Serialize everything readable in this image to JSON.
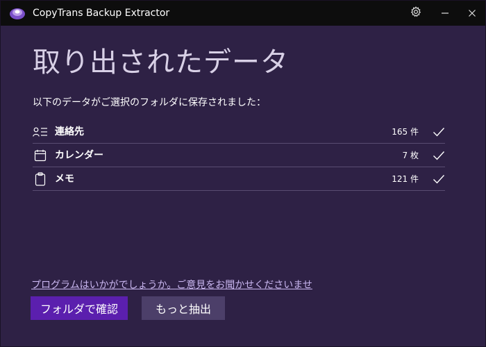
{
  "window": {
    "title": "CopyTrans Backup Extractor"
  },
  "titlebar_icons": {
    "settings": "gear-icon",
    "minimize": "minimize-icon",
    "close": "close-icon"
  },
  "main": {
    "heading": "取り出されたデータ",
    "subtitle": "以下のデータがご選択のフォルダに保存されました：",
    "items": [
      {
        "icon": "contacts-icon",
        "label": "連絡先",
        "count": "165 件",
        "status": "check-icon"
      },
      {
        "icon": "calendar-icon",
        "label": "カレンダー",
        "count": "7 枚",
        "status": "check-icon"
      },
      {
        "icon": "clipboard-icon",
        "label": "メモ",
        "count": "121 件",
        "status": "check-icon"
      }
    ]
  },
  "footer": {
    "feedback_link": "プログラムはいかがでしょうか。ご意見をお聞かせくださいませ",
    "open_folder_button": "フォルダで確認",
    "extract_more_button": "もっと抽出"
  },
  "colors": {
    "background": "#2e2145",
    "titlebar": "#0d0d0d",
    "primary_button": "#5b1fae",
    "secondary_button": "#4c3f69",
    "link": "#c9b6f0",
    "divider": "#5a4d72"
  }
}
